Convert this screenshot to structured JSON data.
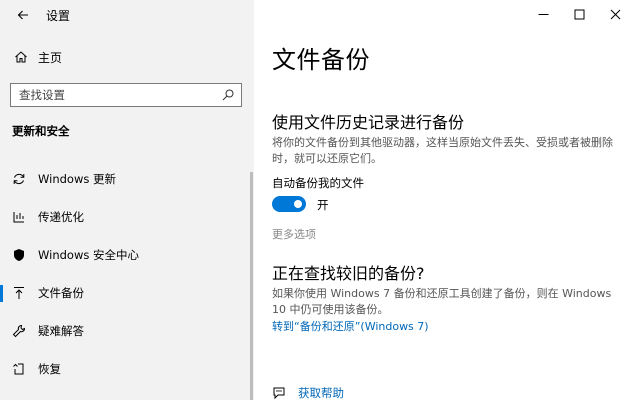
{
  "app": {
    "title": "设置"
  },
  "nav": {
    "home_label": "主页",
    "search_placeholder": "查找设置",
    "section_header": "更新和安全",
    "items": [
      {
        "label": "Windows 更新",
        "icon": "refresh-icon"
      },
      {
        "label": "传递优化",
        "icon": "delivery-optimization-icon"
      },
      {
        "label": "Windows 安全中心",
        "icon": "shield-icon"
      },
      {
        "label": "文件备份",
        "icon": "backup-arrow-icon",
        "active": true
      },
      {
        "label": "疑难解答",
        "icon": "wrench-icon"
      },
      {
        "label": "恢复",
        "icon": "recovery-icon"
      }
    ]
  },
  "content": {
    "title": "文件备份",
    "history": {
      "heading": "使用文件历史记录进行备份",
      "description": "将你的文件备份到其他驱动器，这样当原始文件丢失、受损或者被删除时，就可以还原它们。",
      "auto_backup_label": "自动备份我的文件",
      "toggle_state": "开",
      "toggle_on": true,
      "more_options": "更多选项"
    },
    "older": {
      "heading": "正在查找较旧的备份?",
      "description": "如果你使用 Windows 7 备份和还原工具创建了备份，则在 Windows 10 中仍可使用该备份。",
      "link": "转到“备份和还原”(Windows 7)"
    },
    "help_label": "获取帮助"
  },
  "colors": {
    "accent": "#0078d7",
    "link": "#0067b8",
    "sidebar_bg": "#f2f2f2"
  }
}
